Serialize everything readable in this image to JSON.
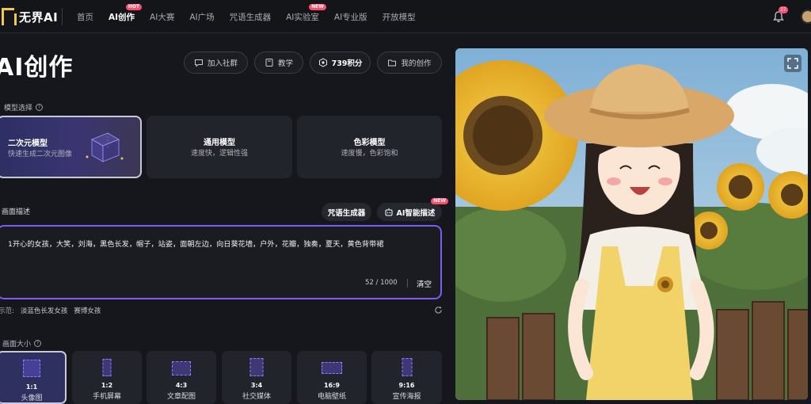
{
  "app": {
    "logo_text": "无界AI",
    "notification_count": "37"
  },
  "nav": [
    {
      "label": "首页",
      "active": false,
      "badge": ""
    },
    {
      "label": "AI创作",
      "active": true,
      "badge": "HOT"
    },
    {
      "label": "AI大赛",
      "active": false,
      "badge": ""
    },
    {
      "label": "AI广场",
      "active": false,
      "badge": ""
    },
    {
      "label": "咒语生成器",
      "active": false,
      "badge": ""
    },
    {
      "label": "AI实验室",
      "active": false,
      "badge": "NEW"
    },
    {
      "label": "AI专业版",
      "active": false,
      "badge": ""
    },
    {
      "label": "开放模型",
      "active": false,
      "badge": ""
    }
  ],
  "header": {
    "title": "AI创作",
    "join_community": "加入社群",
    "tutorial": "教学",
    "points": "739积分",
    "my_creations": "我的创作"
  },
  "model_section": {
    "label": "模型选择",
    "models": [
      {
        "name": "二次元模型",
        "desc": "快速生成二次元图像",
        "selected": true
      },
      {
        "name": "通用模型",
        "desc": "速度快，逻辑性强",
        "selected": false
      },
      {
        "name": "色彩模型",
        "desc": "速度慢，色彩饱和",
        "selected": false
      }
    ]
  },
  "prompt_section": {
    "label": "画面描述",
    "spell_generator": "咒语生成器",
    "ai_describe": "AI智能描述",
    "ai_describe_badge": "NEW",
    "text": "1开心的女孩，大笑，刘海，黑色长发，帽子，站姿，面朝左边，向日葵花墙，户外，花瓣，独奏，夏天，黄色背带裙",
    "counter": "52 / 1000",
    "clear": "清空",
    "hint_prefix": "示范:",
    "hints": [
      "淡蓝色长发女孩",
      "赛博女孩"
    ]
  },
  "size_section": {
    "label": "画面大小",
    "sizes": [
      {
        "ratio": "1:1",
        "name": "头像图",
        "selected": true
      },
      {
        "ratio": "1:2",
        "name": "手机屏幕",
        "selected": false
      },
      {
        "ratio": "4:3",
        "name": "文章配图",
        "selected": false
      },
      {
        "ratio": "3:4",
        "name": "社交媒体",
        "selected": false
      },
      {
        "ratio": "16:9",
        "name": "电脑壁纸",
        "selected": false
      },
      {
        "ratio": "9:16",
        "name": "宣传海报",
        "selected": false
      }
    ]
  },
  "colors": {
    "accent": "#7d5cf2",
    "badge": "#ff4d6d",
    "logo": "#f2c94c"
  }
}
